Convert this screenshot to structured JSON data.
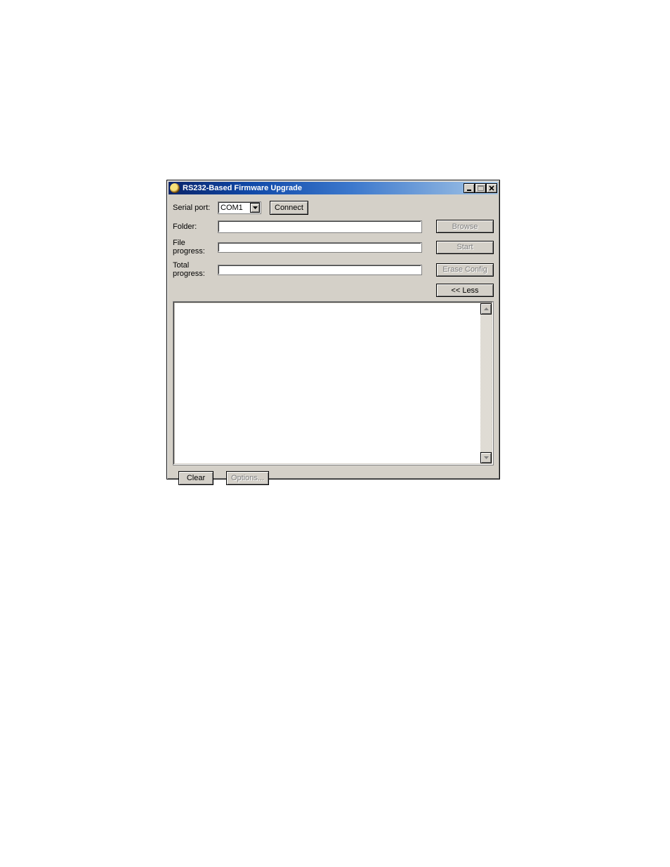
{
  "window": {
    "title": "RS232-Based Firmware Upgrade"
  },
  "titlebar_buttons": {
    "minimize": "minimize",
    "maximize": "maximize",
    "close": "close"
  },
  "labels": {
    "serial_port": "Serial port:",
    "folder": "Folder:",
    "file_progress": "File progress:",
    "total_progress": "Total progress:"
  },
  "serial_port": {
    "selected": "COM1"
  },
  "folder": {
    "value": ""
  },
  "buttons": {
    "connect": "Connect",
    "browse": "Browse",
    "start": "Start",
    "erase_config": "Erase Config",
    "less": "<< Less",
    "clear": "Clear",
    "options": "Options..."
  },
  "log": {
    "text": ""
  }
}
